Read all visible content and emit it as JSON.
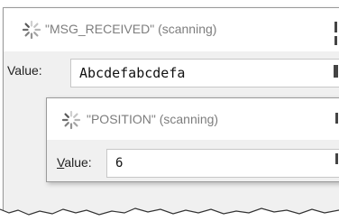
{
  "back_window": {
    "title": "\"MSG_RECEIVED\" (scanning)",
    "value_label": "Value:",
    "value": "Abcdefabcdefa"
  },
  "front_window": {
    "title": "\"POSITION\" (scanning)",
    "value_label_mnemonic": "V",
    "value_label_rest": "alue:",
    "value": "6"
  },
  "icons": {
    "scanning": "spinner-icon"
  },
  "colors": {
    "title_text": "#7d7d7d",
    "window_bg": "#f0f0f0",
    "titlebar_bg": "#ffffff"
  }
}
